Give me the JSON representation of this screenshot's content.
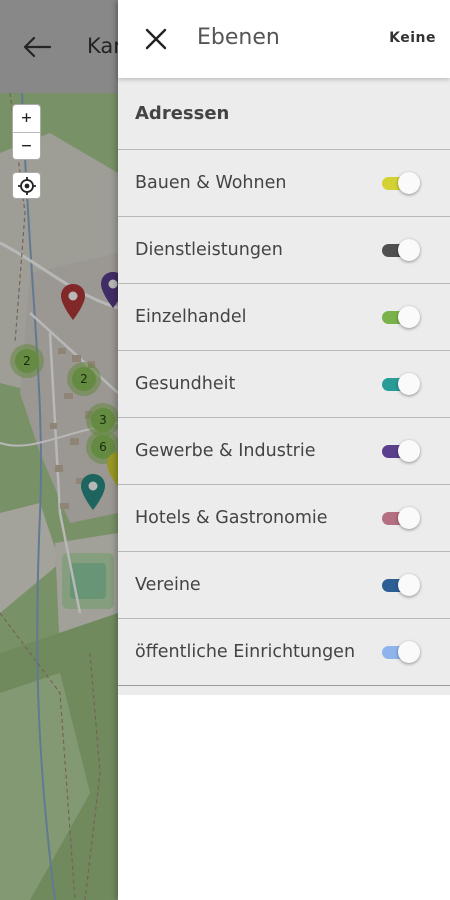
{
  "app_bar": {
    "title": "Kar",
    "back_icon": "arrow-left-icon"
  },
  "map": {
    "zoom_in_label": "+",
    "zoom_out_label": "−",
    "locate_icon": "crosshair-icon",
    "clusters": [
      "2",
      "2",
      "3",
      "6"
    ]
  },
  "drawer": {
    "title": "Ebenen",
    "close_icon": "close-icon",
    "none_label": "Keine",
    "section_title": "Adressen",
    "layers": [
      {
        "label": "Bauen & Wohnen",
        "color": "#d4d233",
        "enabled": true
      },
      {
        "label": "Dienstleistungen",
        "color": "#4f4f4f",
        "enabled": true
      },
      {
        "label": "Einzelhandel",
        "color": "#79b24a",
        "enabled": true
      },
      {
        "label": "Gesundheit",
        "color": "#2a9b96",
        "enabled": true
      },
      {
        "label": "Gewerbe & Industrie",
        "color": "#5b3f8c",
        "enabled": true
      },
      {
        "label": "Hotels & Gastronomie",
        "color": "#b46f82",
        "enabled": true
      },
      {
        "label": "Vereine",
        "color": "#2d5f95",
        "enabled": true
      },
      {
        "label": "öffentliche Einrichtungen",
        "color": "#8fb4ec",
        "enabled": true
      }
    ]
  }
}
